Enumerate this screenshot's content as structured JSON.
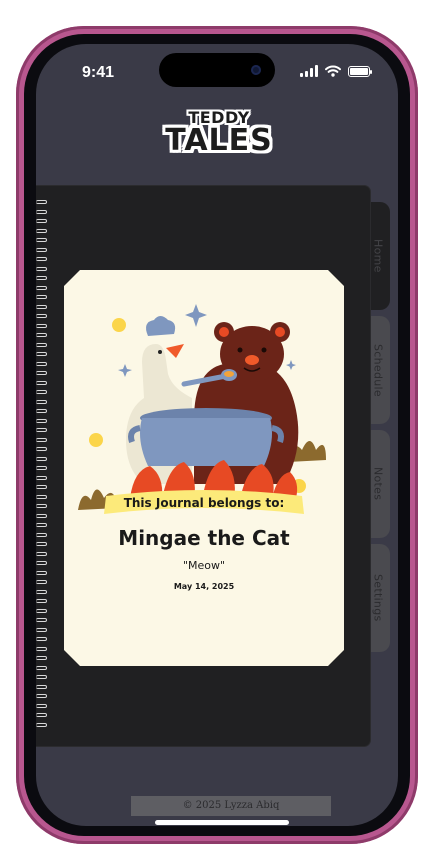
{
  "status_bar": {
    "time": "9:41"
  },
  "logo": {
    "line1": "TEDDY",
    "line2": "TALES"
  },
  "tabs": [
    {
      "label": "Home",
      "active": true
    },
    {
      "label": "Schedule",
      "active": false
    },
    {
      "label": "Notes",
      "active": false
    },
    {
      "label": "Settings",
      "active": false
    }
  ],
  "cover": {
    "banner_text": "This Journal belongs to:",
    "owner_name": "Mingae the Cat",
    "owner_quote": "\"Meow\"",
    "date": "May 14, 2025"
  },
  "footer": {
    "copyright": "© 2025 Lyzza Abiq"
  },
  "colors": {
    "frame": "#b8578f",
    "screen_bg": "#3a3a47",
    "notebook": "#202022",
    "tab": "#4a4a4f",
    "cover_bg": "#fcf8e6",
    "banner_yellow": "#fcea7a",
    "pot_blue": "#7f97bf",
    "bear_brown": "#6b2418",
    "flame_red": "#e74a24"
  },
  "icons": [
    "signal-icon",
    "wifi-icon",
    "battery-icon",
    "spiral-binding-icon"
  ]
}
